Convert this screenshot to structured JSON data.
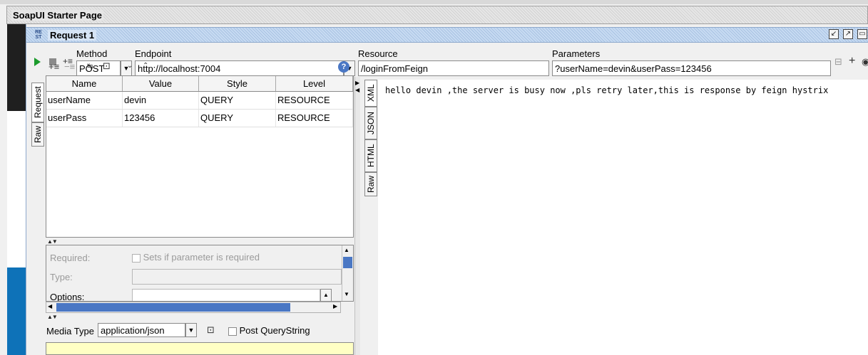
{
  "starter": {
    "title": "SoapUI Starter Page"
  },
  "request": {
    "title": "Request 1",
    "badge": "RE ST"
  },
  "toolbar": {
    "method_label": "Method",
    "method_value": "POST",
    "endpoint_label": "Endpoint",
    "endpoint_value": "http://localhost:7004",
    "resource_label": "Resource",
    "resource_value": "/loginFromFeign",
    "parameters_label": "Parameters",
    "parameters_value": "?userName=devin&userPass=123456"
  },
  "left_tabs": [
    "Request",
    "Raw"
  ],
  "right_tabs": [
    "XML",
    "JSON",
    "HTML",
    "Raw"
  ],
  "params_table": {
    "columns": [
      "Name",
      "Value",
      "Style",
      "Level"
    ],
    "rows": [
      [
        "userName",
        "devin",
        "QUERY",
        "RESOURCE"
      ],
      [
        "userPass",
        "123456",
        "QUERY",
        "RESOURCE"
      ]
    ]
  },
  "details": {
    "required_label": "Required:",
    "required_text": "Sets if parameter is required",
    "type_label": "Type:",
    "options_label": "Options:"
  },
  "media": {
    "label": "Media Type",
    "value": "application/json",
    "post_qs": "Post QueryString"
  },
  "response": {
    "text": "hello devin ,the server is busy now ,pls retry later,this is response by feign hystrix"
  },
  "colors": {
    "play": "#1b9b2c",
    "scroll_thumb": "#4a77c4",
    "media_area": "#ffffc4",
    "side_blue": "#0e72b8"
  }
}
